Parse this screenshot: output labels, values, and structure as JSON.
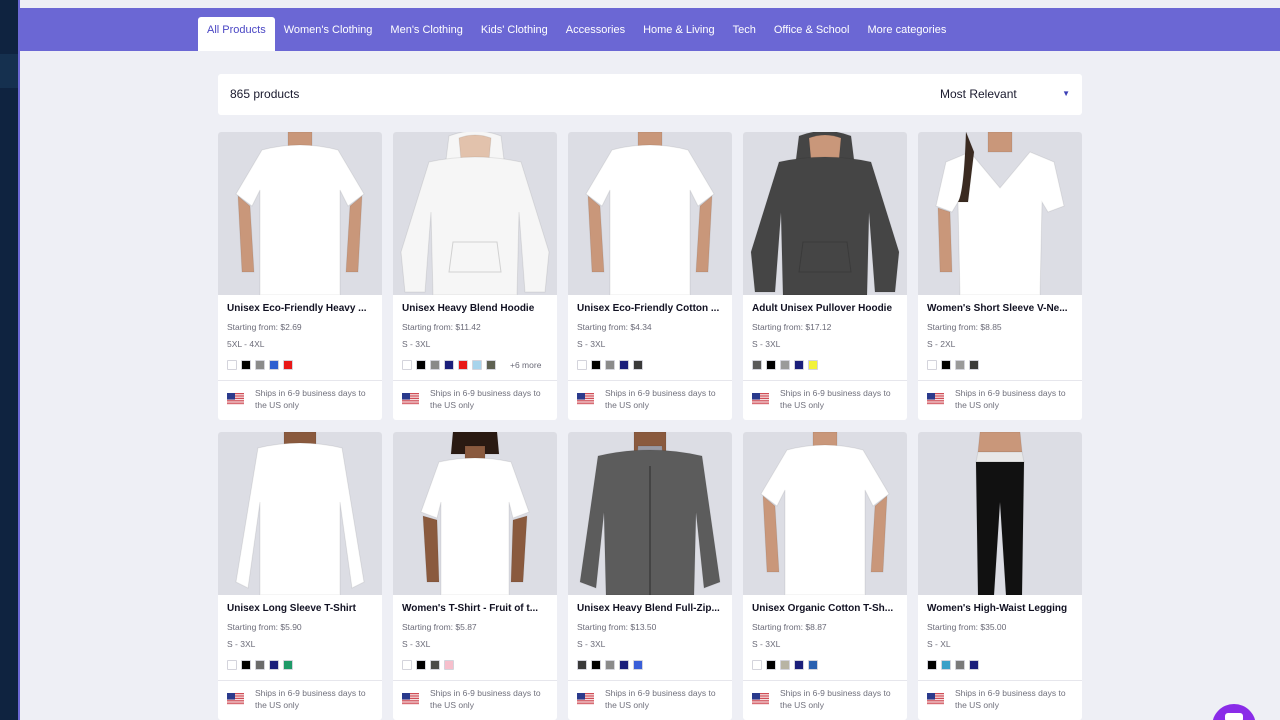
{
  "nav": {
    "tabs": [
      {
        "label": "All Products",
        "active": true
      },
      {
        "label": "Women's Clothing",
        "active": false
      },
      {
        "label": "Men's Clothing",
        "active": false
      },
      {
        "label": "Kids' Clothing",
        "active": false
      },
      {
        "label": "Accessories",
        "active": false
      },
      {
        "label": "Home & Living",
        "active": false
      },
      {
        "label": "Tech",
        "active": false
      },
      {
        "label": "Office & School",
        "active": false
      },
      {
        "label": "More categories",
        "active": false
      }
    ]
  },
  "toolbar": {
    "product_count": "865 products",
    "sort_value": "Most Relevant",
    "sort_icon": "chevron-down-icon"
  },
  "colors": {
    "accent": "#6b67d4",
    "active_tab_text": "#4b47c4",
    "chat_button": "#8a2ce8"
  },
  "products": [
    {
      "title": "Unisex Eco-Friendly Heavy ...",
      "price": "Starting from: $2.69",
      "sizes": "5XL - 4XL",
      "swatches": [
        "#ffffff",
        "#000000",
        "#8a8a8a",
        "#2f5fd0",
        "#e81818"
      ],
      "more": "",
      "ship": "Ships in 6-9 business days to the US only",
      "garment": "tee",
      "shade": "#ffffff"
    },
    {
      "title": "Unisex Heavy Blend Hoodie",
      "price": "Starting from: $11.42",
      "sizes": "S - 3XL",
      "swatches": [
        "#ffffff",
        "#000000",
        "#8a8a8a",
        "#1b1f7a",
        "#e81818",
        "#a8d4ec",
        "#5e6152"
      ],
      "more": "+6 more",
      "ship": "Ships in 6-9 business days to the US only",
      "garment": "hoodie",
      "shade": "#f6f6f6"
    },
    {
      "title": "Unisex Eco-Friendly Cotton ...",
      "price": "Starting from: $4.34",
      "sizes": "S - 3XL",
      "swatches": [
        "#ffffff",
        "#000000",
        "#8a8a8a",
        "#1b1f7a",
        "#3a3a3a"
      ],
      "more": "",
      "ship": "Ships in 6-9 business days to the US only",
      "garment": "tee",
      "shade": "#ffffff"
    },
    {
      "title": "Adult Unisex Pullover Hoodie",
      "price": "Starting from: $17.12",
      "sizes": "S - 3XL",
      "swatches": [
        "#5a5a5a",
        "#000000",
        "#9a9a9a",
        "#1b1f7a",
        "#f2f23a"
      ],
      "more": "",
      "ship": "Ships in 6-9 business days to the US only",
      "garment": "hoodie",
      "shade": "#454545"
    },
    {
      "title": "Women's Short Sleeve V-Ne...",
      "price": "Starting from: $8.85",
      "sizes": "S - 2XL",
      "swatches": [
        "#ffffff",
        "#000000",
        "#9a9a9a",
        "#3a3a3a"
      ],
      "more": "",
      "ship": "Ships in 6-9 business days to the US only",
      "garment": "vneck",
      "shade": "#ffffff"
    },
    {
      "title": "Unisex Long Sleeve T-Shirt",
      "price": "Starting from: $5.90",
      "sizes": "S - 3XL",
      "swatches": [
        "#ffffff",
        "#000000",
        "#6a6a6a",
        "#1b1f7a",
        "#1f9a68"
      ],
      "more": "",
      "ship": "Ships in 6-9 business days to the US only",
      "garment": "longsleeve",
      "shade": "#ffffff"
    },
    {
      "title": "Women's T-Shirt - Fruit of t...",
      "price": "Starting from: $5.87",
      "sizes": "S - 3XL",
      "swatches": [
        "#ffffff",
        "#000000",
        "#4a4a4a",
        "#f6bfcc"
      ],
      "more": "",
      "ship": "Ships in 6-9 business days to the US only",
      "garment": "womentee",
      "shade": "#ffffff"
    },
    {
      "title": "Unisex Heavy Blend Full-Zip...",
      "price": "Starting from: $13.50",
      "sizes": "S - 3XL",
      "swatches": [
        "#3a3a3a",
        "#000000",
        "#8a8a8a",
        "#1b1f7a",
        "#3a5fd8"
      ],
      "more": "",
      "ship": "Ships in 6-9 business days to the US only",
      "garment": "zip",
      "shade": "#5c5c5c"
    },
    {
      "title": "Unisex Organic Cotton T-Sh...",
      "price": "Starting from: $8.87",
      "sizes": "S - 3XL",
      "swatches": [
        "#ffffff",
        "#000000",
        "#b8b4a4",
        "#1b1f7a",
        "#2a60b0"
      ],
      "more": "",
      "ship": "Ships in 6-9 business days to the US only",
      "garment": "tee",
      "shade": "#ffffff"
    },
    {
      "title": "Women's High-Waist Legging",
      "price": "Starting from: $35.00",
      "sizes": "S - XL",
      "swatches": [
        "#000000",
        "#3aa0c8",
        "#7a7a7a",
        "#1b1f7a"
      ],
      "more": "",
      "ship": "Ships in 6-9 business days to the US only",
      "garment": "legging",
      "shade": "#111111"
    }
  ]
}
